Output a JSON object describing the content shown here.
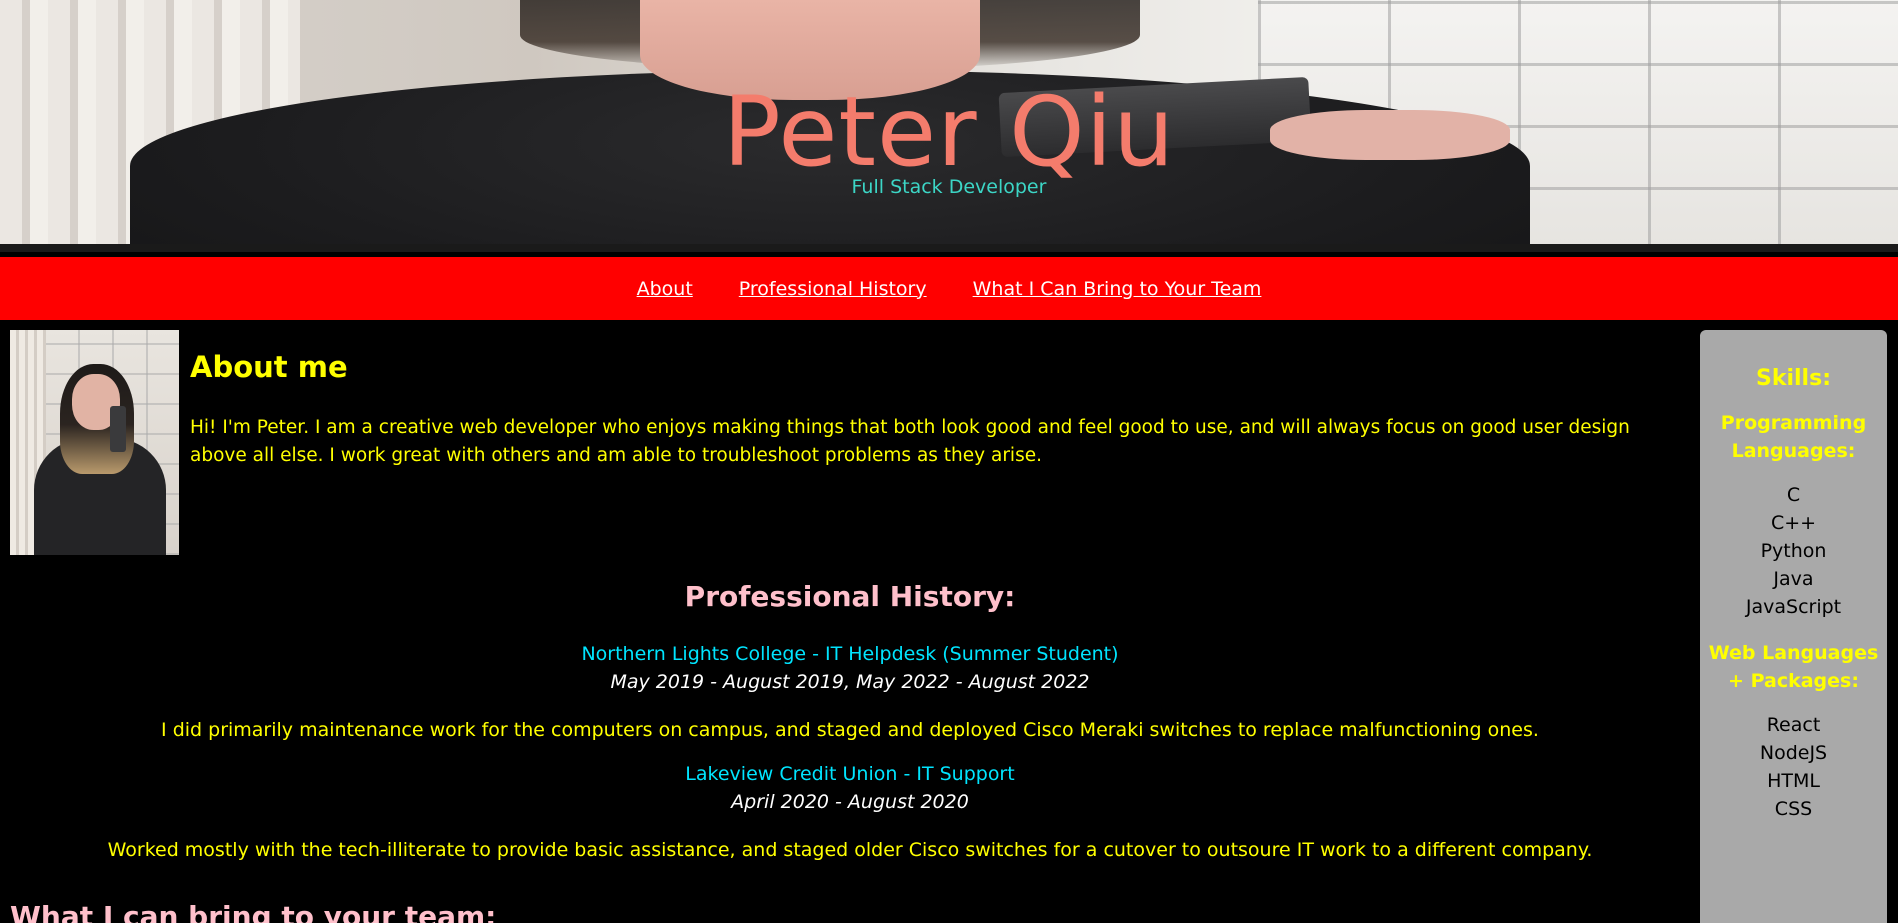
{
  "header": {
    "title": "Peter Qiu",
    "subtitle": "Full Stack Developer"
  },
  "nav": {
    "items": [
      {
        "label": "About"
      },
      {
        "label": "Professional History"
      },
      {
        "label": "What I Can Bring to Your Team"
      }
    ]
  },
  "about": {
    "heading": "About me",
    "text": "Hi! I'm Peter. I am a creative web developer who enjoys making things that both look good and feel good to use, and will always focus on good user design above all else. I work great with others and am able to troubleshoot problems as they arise."
  },
  "history": {
    "heading": "Professional History:",
    "jobs": [
      {
        "title": "Northern Lights College - IT Helpdesk (Summer Student)",
        "dates": "May 2019 - August 2019, May 2022 - August 2022",
        "description": "I did primarily maintenance work for the computers on campus, and staged and deployed Cisco Meraki switches to replace malfunctioning ones."
      },
      {
        "title": "Lakeview Credit Union - IT Support",
        "dates": "April 2020 - August 2020",
        "description": "Worked mostly with the tech-illiterate to provide basic assistance, and staged older Cisco switches for a cutover to outsoure IT work to a different company."
      }
    ]
  },
  "team": {
    "heading": "What I can bring to your team:"
  },
  "skills": {
    "heading": "Skills:",
    "groups": [
      {
        "title": "Programming Languages:",
        "items": [
          "C",
          "C++",
          "Python",
          "Java",
          "JavaScript"
        ]
      },
      {
        "title": "Web Languages + Packages:",
        "items": [
          "React",
          "NodeJS",
          "HTML",
          "CSS"
        ]
      }
    ]
  },
  "colors": {
    "nav_background": "#ff0000",
    "title": "#f47c6c",
    "subtitle": "#3cd6c6",
    "about_text": "#ffff00",
    "history_heading": "#ffc0cb",
    "job_title": "#00e5ff",
    "skills_panel": "#a9a9a9"
  }
}
